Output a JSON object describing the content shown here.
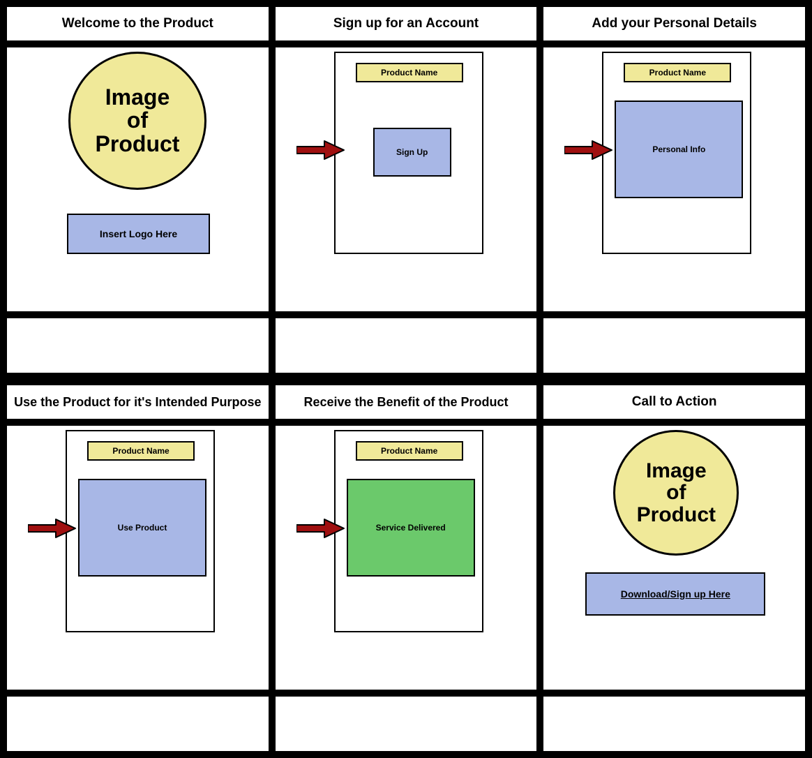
{
  "cells": [
    {
      "title": "Welcome to the Product",
      "circle_text": "Image of Product",
      "logo_text": "Insert Logo Here"
    },
    {
      "title": "Sign up for an Account",
      "product_name": "Product Name",
      "action_label": "Sign Up"
    },
    {
      "title": "Add your Personal Details",
      "product_name": "Product Name",
      "action_label": "Personal Info"
    },
    {
      "title": "Use the Product for it's Intended Purpose",
      "product_name": "Product Name",
      "action_label": "Use Product"
    },
    {
      "title": "Receive the Benefit of the Product",
      "product_name": "Product Name",
      "action_label": "Service Delivered"
    },
    {
      "title": "Call to Action",
      "circle_text": "Image of Product",
      "cta_text": "Download/Sign up Here"
    }
  ],
  "colors": {
    "yellow": "#f0e999",
    "blue": "#a8b7e6",
    "green": "#6bc96b",
    "arrow": "#a01010"
  }
}
